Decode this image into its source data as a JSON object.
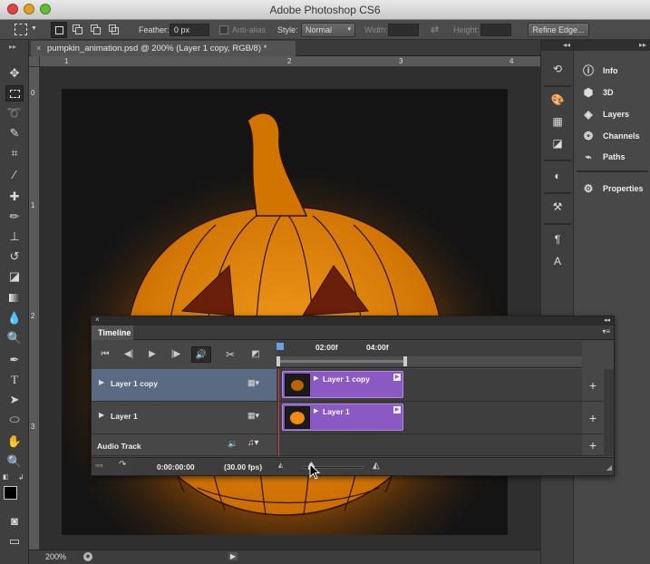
{
  "app": {
    "title": "Adobe Photoshop CS6"
  },
  "options_bar": {
    "feather_label": "Feather:",
    "feather_value": "0 px",
    "antialias_label": "Anti-alias",
    "style_label": "Style:",
    "style_value": "Normal",
    "width_label": "Width:",
    "height_label": "Height:",
    "refine_edge_label": "Refine Edge..."
  },
  "document": {
    "tab_title": "pumpkin_animation.psd @ 200% (Layer 1 copy, RGB/8) *",
    "ruler_h": [
      "1",
      "2",
      "3",
      "4"
    ],
    "ruler_v": [
      "0",
      "1",
      "2",
      "3"
    ],
    "zoom": "200%"
  },
  "panels": {
    "items": [
      {
        "label": "Info",
        "icon": "info-icon"
      },
      {
        "label": "3D",
        "icon": "cube-icon"
      },
      {
        "label": "Layers",
        "icon": "layers-icon"
      },
      {
        "label": "Channels",
        "icon": "channels-icon"
      },
      {
        "label": "Paths",
        "icon": "paths-icon"
      },
      {
        "label": "Properties",
        "icon": "properties-icon"
      }
    ]
  },
  "timeline": {
    "tab": "Timeline",
    "ruler": [
      "02:00f",
      "04:00f"
    ],
    "layers": [
      {
        "name": "Layer 1 copy",
        "clip": "Layer 1 copy",
        "selected": true
      },
      {
        "name": "Layer 1",
        "clip": "Layer 1",
        "selected": false
      }
    ],
    "audio_track": "Audio Track",
    "timecode": "0:00:00:00",
    "fps": "(30.00 fps)"
  },
  "colors": {
    "accent_clip": "#8b59c3",
    "pumpkin": "#e07a00",
    "selected_row": "#5a6a82"
  }
}
